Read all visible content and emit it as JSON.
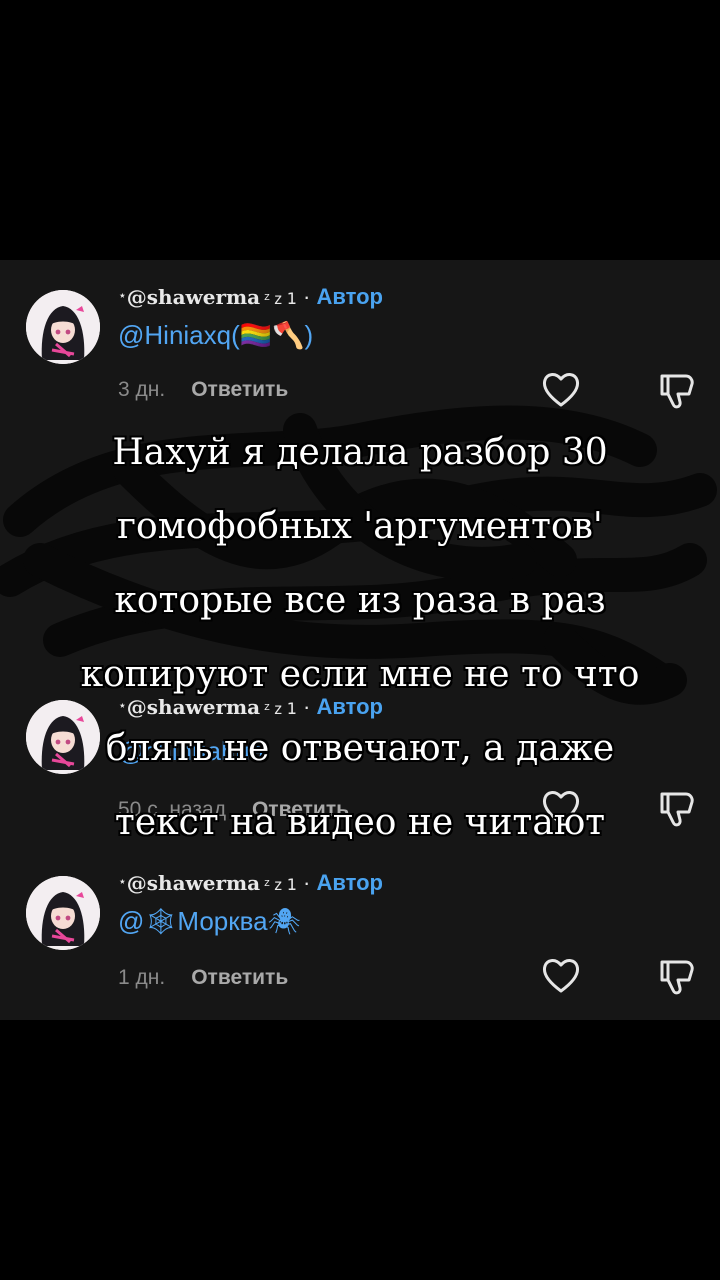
{
  "comments": [
    {
      "star": "⋆",
      "username": "@shawerma",
      "zz": "ᶻ z 𝟣",
      "dot": " · ",
      "author_label": "Автор",
      "mention": "@Hiniaxq(🏳️‍🌈🪓)",
      "time": "3 дн.",
      "reply_label": "Ответить"
    },
    {
      "star": "⋆",
      "username": "@shawerma",
      "zz": "ᶻ z 𝟣",
      "dot": " · ",
      "author_label": "Автор",
      "mention": "@chihuahua",
      "time": "50 с. назад",
      "reply_label": "Ответить"
    },
    {
      "star": "⋆",
      "username": "@shawerma",
      "zz": "ᶻ z 𝟣",
      "dot": " · ",
      "author_label": "Автор",
      "mention": "@🕸Морква🕷",
      "time": "1 дн.",
      "reply_label": "Ответить"
    }
  ],
  "overlay_caption": {
    "line1": "Нахуй я делала разбор 30",
    "line2": "гомофобных 'аргументов'",
    "line3": "которые все из раза в раз",
    "line4": "копируют если мне не то что",
    "line5": "блять не отвечают, а даже",
    "line6": "текст на видео не читают"
  },
  "colors": {
    "background": "#000000",
    "panel": "#161616",
    "author_accent": "#4aa3f0",
    "mention": "#52a6f3",
    "scribble": "#0a0a0a"
  }
}
